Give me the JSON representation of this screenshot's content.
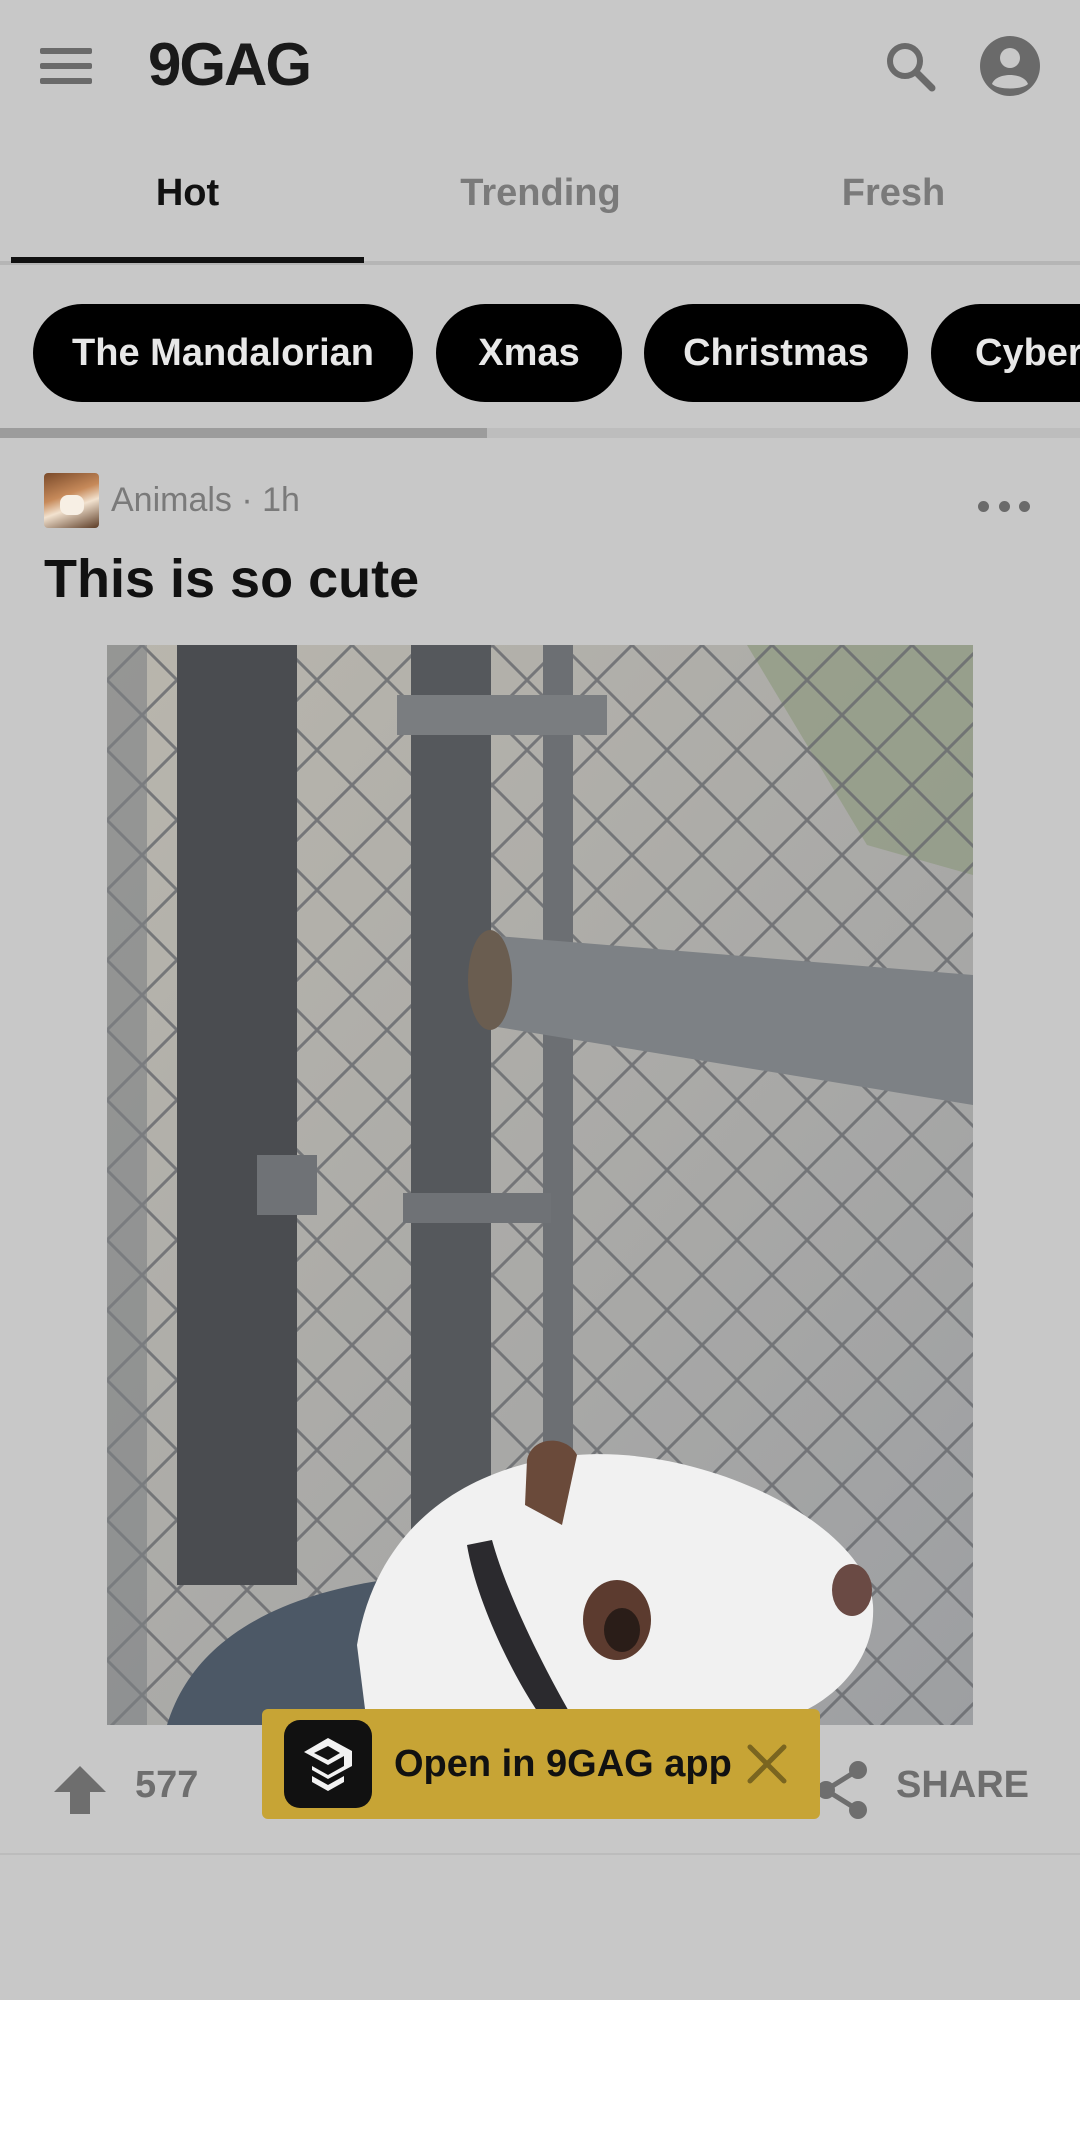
{
  "header": {
    "logo": "9GAG",
    "menu_icon": "hamburger-menu-icon",
    "search_icon": "search-icon",
    "profile_icon": "account-circle-icon"
  },
  "tabs": [
    {
      "label": "Hot",
      "active": true
    },
    {
      "label": "Trending",
      "active": false
    },
    {
      "label": "Fresh",
      "active": false
    }
  ],
  "tags": [
    "The Mandalorian",
    "Xmas",
    "Christmas",
    "Cyberp"
  ],
  "post": {
    "section": "Animals · 1h",
    "title": "This is so cute",
    "upvotes": "577",
    "share_label": "SHARE"
  },
  "app_banner": {
    "text": "Open in 9GAG app"
  },
  "colors": {
    "overlay_background": "#c8c8c8",
    "banner_accent": "#c7a435",
    "chip_background": "#000000"
  }
}
